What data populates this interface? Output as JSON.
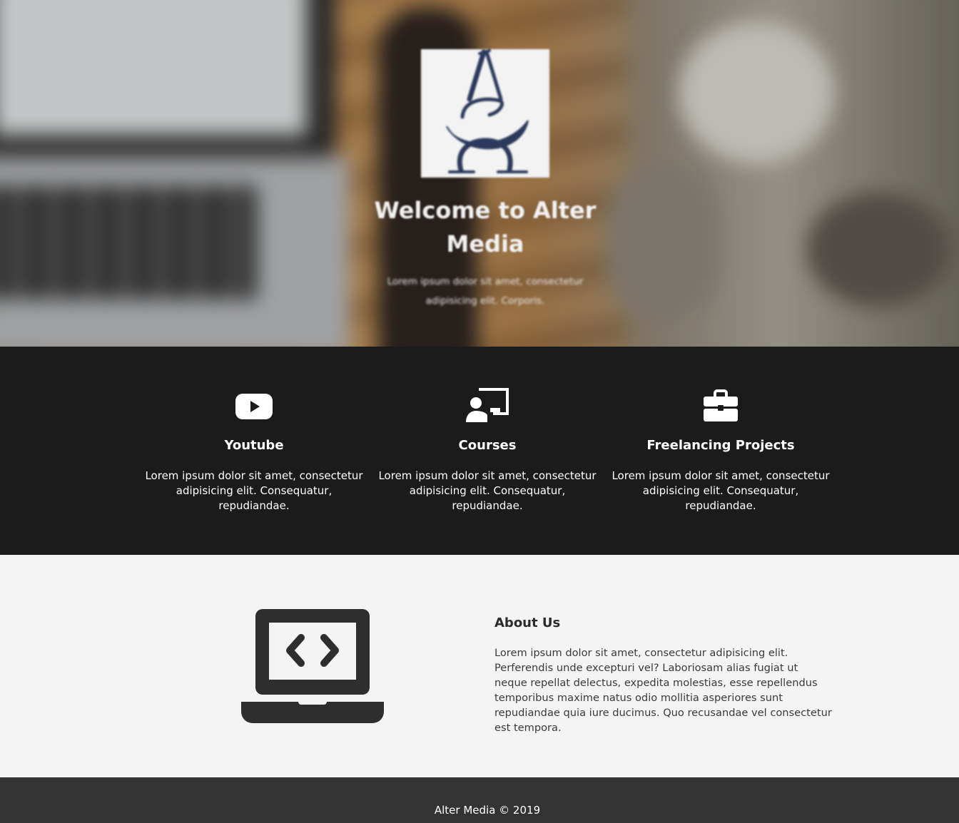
{
  "hero": {
    "logo_icon": "alter-media-logo",
    "title": "Welcome to Alter Media",
    "subtitle": "Lorem ipsum dolor sit amet, consectetur adipisicing elit. Corporis."
  },
  "services": [
    {
      "icon": "youtube-icon",
      "title": "Youtube",
      "text": "Lorem ipsum dolor sit amet, consectetur adipisicing elit. Consequatur, repudiandae."
    },
    {
      "icon": "chalkboard-teacher-icon",
      "title": "Courses",
      "text": "Lorem ipsum dolor sit amet, consectetur adipisicing elit. Consequatur, repudiandae."
    },
    {
      "icon": "briefcase-icon",
      "title": "Freelancing Projects",
      "text": "Lorem ipsum dolor sit amet, consectetur adipisicing elit. Consequatur, repudiandae."
    }
  ],
  "about": {
    "icon": "laptop-code-icon",
    "title": "About Us",
    "text": "Lorem ipsum dolor sit amet, consectetur adipisicing elit. Perferendis unde excepturi vel? Laboriosam alias fugiat ut neque repellat delectus, expedita molestias, esse repellendus temporibus maxime natus odio mollitia asperiores sunt repudiandae quia iure ducimus. Quo recusandae vel consectetur est tempora."
  },
  "footer": {
    "text": "Alter Media © 2019"
  },
  "colors": {
    "services_bg": "#1b1b1b",
    "about_bg": "#f4f4f4",
    "footer_bg": "#333333",
    "logo_ink": "#2b3a5c"
  }
}
